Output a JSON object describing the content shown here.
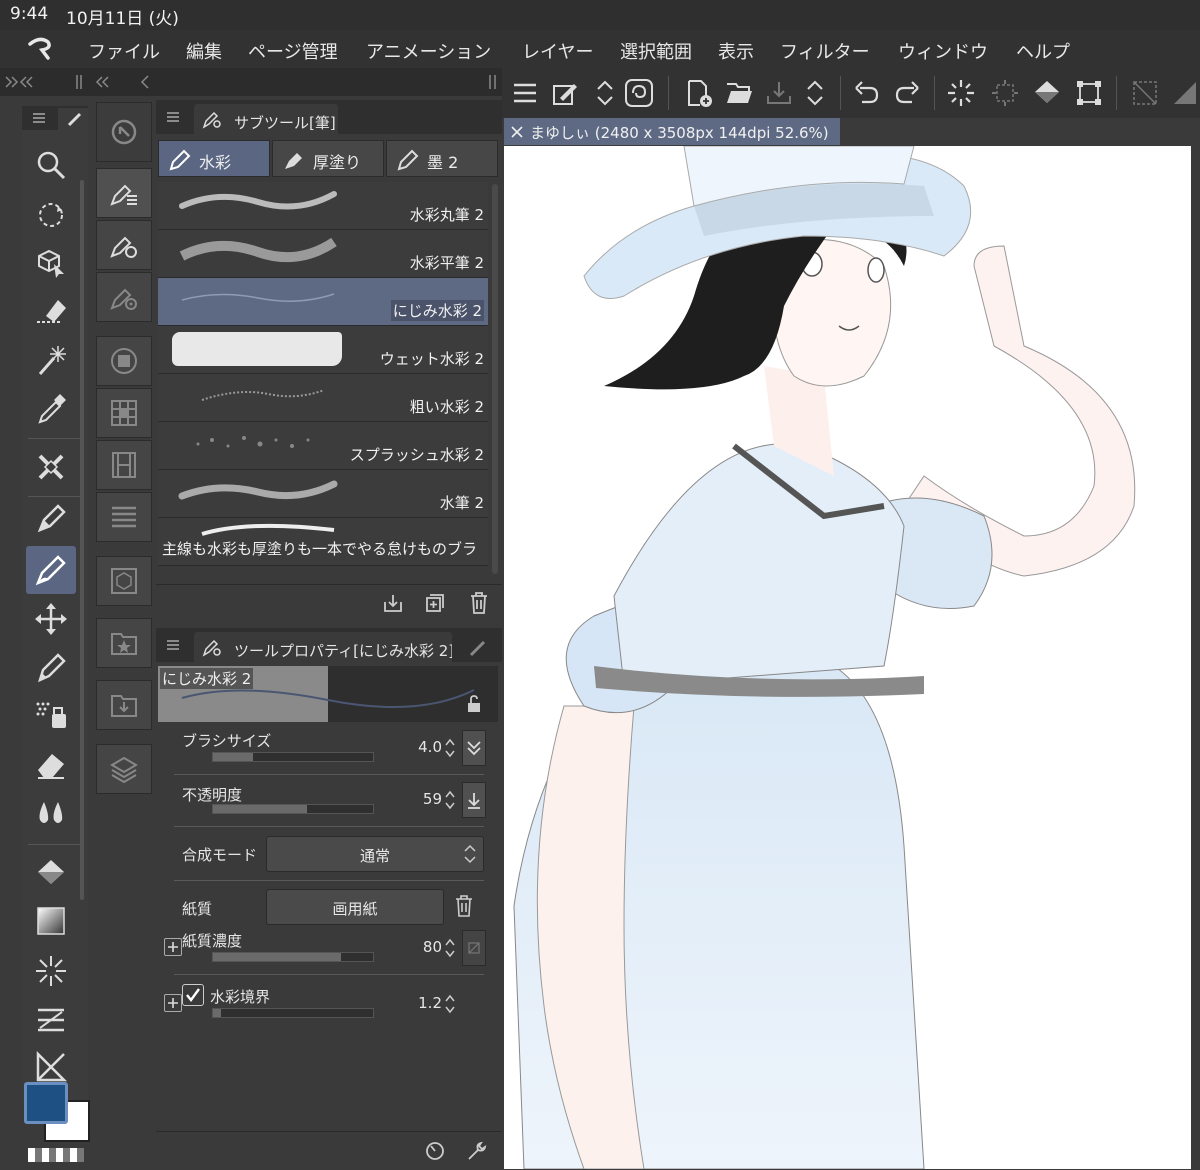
{
  "status_bar": {
    "time": "9:44",
    "date": "10月11日 (火)"
  },
  "menu": [
    "ファイル",
    "編集",
    "ページ管理",
    "アニメーション",
    "レイヤー",
    "選択範囲",
    "表示",
    "フィルター",
    "ウィンドウ",
    "ヘルプ"
  ],
  "subtool_panel": {
    "title": "サブツール[筆]",
    "tabs": [
      {
        "label": "水彩",
        "active": true
      },
      {
        "label": "厚塗り",
        "active": false
      },
      {
        "label": "墨 2",
        "active": false
      }
    ],
    "brushes": [
      {
        "name": "水彩丸筆 2",
        "selected": false
      },
      {
        "name": "水彩平筆 2",
        "selected": false
      },
      {
        "name": "にじみ水彩 2",
        "selected": true
      },
      {
        "name": "ウェット水彩 2",
        "selected": false
      },
      {
        "name": "粗い水彩 2",
        "selected": false
      },
      {
        "name": "スプラッシュ水彩 2",
        "selected": false
      },
      {
        "name": "水筆 2",
        "selected": false
      },
      {
        "name": "主線も水彩も厚塗りも一本でやる怠けものブラ",
        "selected": false
      }
    ]
  },
  "tool_property": {
    "title": "ツールプロパティ[にじみ水彩 2]",
    "preview_label": "にじみ水彩 2",
    "brush_size": {
      "label": "ブラシサイズ",
      "value": "4.0",
      "fraction": 0.25
    },
    "opacity": {
      "label": "不透明度",
      "value": "59",
      "fraction": 0.59
    },
    "blend_mode": {
      "label": "合成モード",
      "value": "通常"
    },
    "paper": {
      "label": "紙質",
      "value": "画用紙"
    },
    "paper_density": {
      "label": "紙質濃度",
      "value": "80",
      "fraction": 0.8
    },
    "watercolor_edge": {
      "label": "水彩境界",
      "value": "1.2",
      "fraction": 0.05,
      "checked": true
    }
  },
  "canvas_tab": {
    "label": "まゆしぃ (2480 x 3508px 144dpi 52.6%)"
  },
  "colors": {
    "main": "#1f5084",
    "sub": "#ffffff",
    "accent": "#5e6a84"
  }
}
